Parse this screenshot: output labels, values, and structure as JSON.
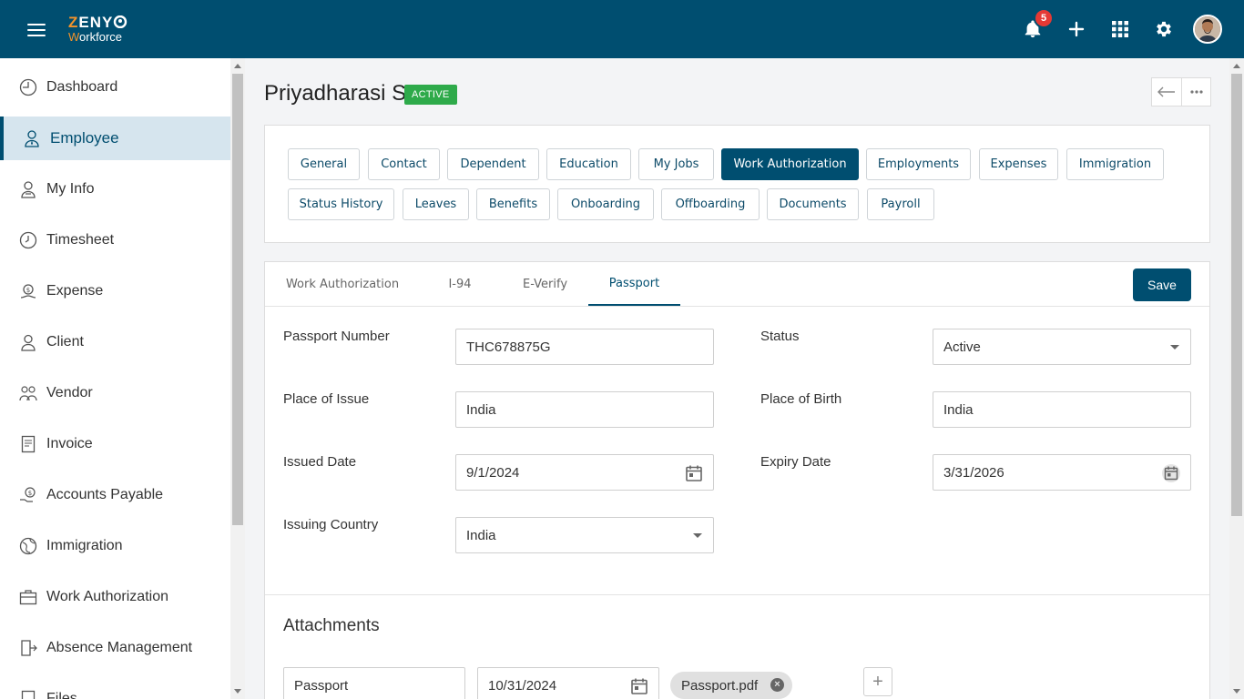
{
  "brand": {
    "line1_highlight": "Z",
    "line1_rest": "ENY",
    "line2_highlight": "W",
    "line2_rest": "orkforce"
  },
  "topbar": {
    "notification_count": "5"
  },
  "sidebar": {
    "items": [
      {
        "label": "Dashboard",
        "icon": "dashboard-icon"
      },
      {
        "label": "Employee",
        "icon": "employee-icon"
      },
      {
        "label": "My Info",
        "icon": "my-info-icon"
      },
      {
        "label": "Timesheet",
        "icon": "clock-icon"
      },
      {
        "label": "Expense",
        "icon": "expense-icon"
      },
      {
        "label": "Client",
        "icon": "client-icon"
      },
      {
        "label": "Vendor",
        "icon": "vendor-icon"
      },
      {
        "label": "Invoice",
        "icon": "invoice-icon"
      },
      {
        "label": "Accounts Payable",
        "icon": "accounts-payable-icon"
      },
      {
        "label": "Immigration",
        "icon": "globe-icon"
      },
      {
        "label": "Work Authorization",
        "icon": "briefcase-icon"
      },
      {
        "label": "Absence Management",
        "icon": "exit-icon"
      },
      {
        "label": "Files",
        "icon": "files-icon"
      }
    ],
    "active_index": 1
  },
  "employee": {
    "name": "Priyadharasi S",
    "status": "ACTIVE"
  },
  "nav_tabs": {
    "row1": [
      "General",
      "Contact",
      "Dependent",
      "Education",
      "My Jobs",
      "Work Authorization",
      "Employments",
      "Expenses",
      "Immigration"
    ],
    "row2": [
      "Status History",
      "Leaves",
      "Benefits",
      "Onboarding",
      "Offboarding",
      "Documents",
      "Payroll"
    ],
    "active": "Work Authorization"
  },
  "sub_tabs": {
    "items": [
      "Work Authorization",
      "I-94",
      "E-Verify",
      "Passport"
    ],
    "active": "Passport",
    "save_label": "Save"
  },
  "form": {
    "passport_number": {
      "label": "Passport Number",
      "value": "THC678875G"
    },
    "status": {
      "label": "Status",
      "value": "Active"
    },
    "place_of_issue": {
      "label": "Place of Issue",
      "value": "India"
    },
    "place_of_birth": {
      "label": "Place of Birth",
      "value": "India"
    },
    "issued_date": {
      "label": "Issued Date",
      "value": "9/1/2024"
    },
    "expiry_date": {
      "label": "Expiry Date",
      "value": "3/31/2026"
    },
    "issuing_country": {
      "label": "Issuing Country",
      "value": "India"
    }
  },
  "attachments": {
    "title": "Attachments",
    "rows": [
      {
        "type": "Passport",
        "date": "10/31/2024",
        "file": "Passport.pdf"
      }
    ]
  }
}
